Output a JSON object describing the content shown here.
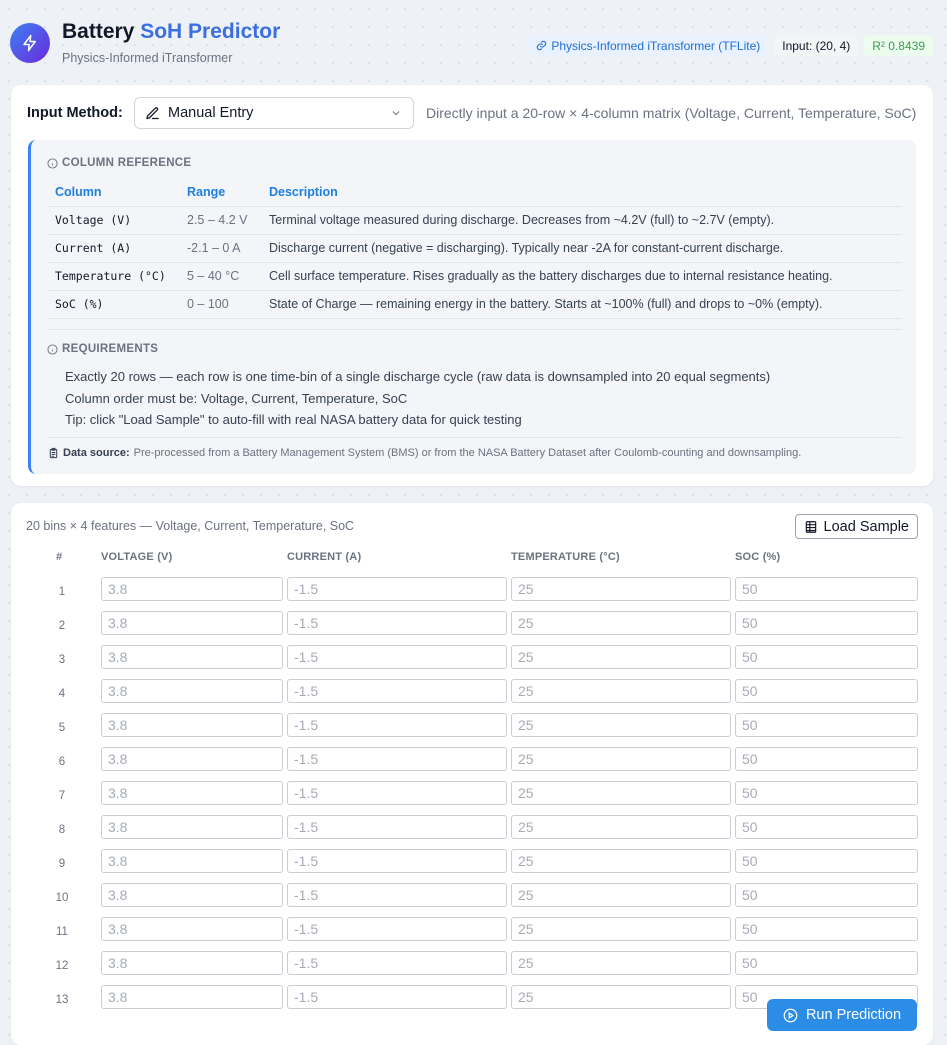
{
  "header": {
    "title_main": "Battery",
    "title_accent": "SoH Predictor",
    "subtitle": "Physics-Informed iTransformer",
    "badges": {
      "model": "Physics-Informed iTransformer (TFLite)",
      "input": "Input: (20, 4)",
      "r2": "R² 0.8439"
    }
  },
  "input_method": {
    "label": "Input Method:",
    "selected": "Manual Entry",
    "help": "Directly input a 20-row × 4-column matrix (Voltage, Current, Temperature, SoC)"
  },
  "column_reference": {
    "title": "COLUMN REFERENCE",
    "headers": {
      "column": "Column",
      "range": "Range",
      "description": "Description"
    },
    "rows": [
      {
        "column": "Voltage (V)",
        "range": "2.5 – 4.2 V",
        "description": "Terminal voltage measured during discharge. Decreases from ~4.2V (full) to ~2.7V (empty)."
      },
      {
        "column": "Current (A)",
        "range": "-2.1 – 0 A",
        "description": "Discharge current (negative = discharging). Typically near -2A for constant-current discharge."
      },
      {
        "column": "Temperature (°C)",
        "range": "5 – 40 °C",
        "description": "Cell surface temperature. Rises gradually as the battery discharges due to internal resistance heating."
      },
      {
        "column": "SoC (%)",
        "range": "0 – 100",
        "description": "State of Charge — remaining energy in the battery. Starts at ~100% (full) and drops to ~0% (empty)."
      }
    ]
  },
  "requirements": {
    "title": "REQUIREMENTS",
    "items": [
      "Exactly 20 rows — each row is one time-bin of a single discharge cycle (raw data is downsampled into 20 equal segments)",
      "Column order must be: Voltage, Current, Temperature, SoC",
      "Tip: click \"Load Sample\" to auto-fill with real NASA battery data for quick testing"
    ]
  },
  "data_source": {
    "label": "Data source:",
    "text": "Pre-processed from a Battery Management System (BMS) or from the NASA Battery Dataset after Coulomb-counting and downsampling."
  },
  "matrix": {
    "info": "20 bins × 4 features — Voltage, Current, Temperature, SoC",
    "load_sample": "Load Sample",
    "headers": {
      "num": "#",
      "voltage": "VOLTAGE (V)",
      "current": "CURRENT (A)",
      "temperature": "TEMPERATURE (°C)",
      "soc": "SOC (%)"
    },
    "placeholders": {
      "voltage": "3.8",
      "current": "-1.5",
      "temperature": "25",
      "soc": "50"
    },
    "row_numbers": [
      "1",
      "2",
      "3",
      "4",
      "5",
      "6",
      "7",
      "8",
      "9",
      "10",
      "11",
      "12",
      "13"
    ]
  },
  "run_button": "Run Prediction",
  "colors": {
    "accent": "#2b8de6",
    "brand_gradient_start": "#3b82f6",
    "brand_gradient_end": "#6d28d9",
    "r2_green": "#3f9d4f"
  },
  "icons": [
    "bolt-icon",
    "link-icon",
    "pencil-icon",
    "chevron-down-icon",
    "info-icon",
    "clipboard-icon",
    "table-icon",
    "play-circle-icon"
  ]
}
